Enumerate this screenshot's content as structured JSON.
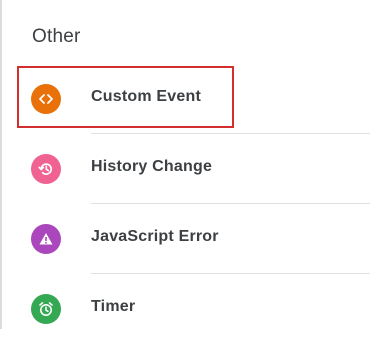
{
  "section": {
    "title": "Other"
  },
  "items": [
    {
      "label": "Custom Event",
      "icon": "code-brackets-icon",
      "color": "#e8710a",
      "selected": true
    },
    {
      "label": "History Change",
      "icon": "history-icon",
      "color": "#f06292",
      "selected": false
    },
    {
      "label": "JavaScript Error",
      "icon": "warning-icon",
      "color": "#ab47bc",
      "selected": false
    },
    {
      "label": "Timer",
      "icon": "alarm-clock-icon",
      "color": "#34a853",
      "selected": false
    }
  ],
  "colors": {
    "selection_border": "#d32f2f",
    "text": "#3c4043",
    "divider": "#e0e0e0"
  }
}
